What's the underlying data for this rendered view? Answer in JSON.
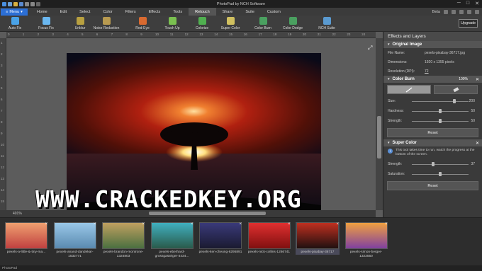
{
  "window": {
    "title": "PhotoPad by NCH Software",
    "controls": [
      "─",
      "□",
      "✕"
    ]
  },
  "menubar": {
    "menu_label": "Menu",
    "tabs": [
      "Home",
      "Edit",
      "Select",
      "Color",
      "Filters",
      "Effects",
      "Tools",
      "Retouch",
      "Share",
      "Suite",
      "Custom"
    ],
    "active_tab": "Retouch",
    "right_label": "Beta"
  },
  "toolbar": {
    "items": [
      {
        "label": "Auto Fix",
        "icon": "auto-fix-icon",
        "color": "#4aa3e8"
      },
      {
        "label": "Focus Fix",
        "icon": "focus-fix-icon",
        "color": "#6ab7f0"
      },
      {
        "label": "Unblur",
        "icon": "unblur-icon",
        "color": "#b8a040"
      },
      {
        "label": "Noise Reduction",
        "icon": "noise-reduction-icon",
        "color": "#b89a50"
      },
      {
        "label": "Red-Eye",
        "icon": "red-eye-icon",
        "color": "#d96a30"
      },
      {
        "label": "Touch Up",
        "icon": "touch-up-icon",
        "color": "#7ac050"
      },
      {
        "label": "Colorize",
        "icon": "colorize-icon",
        "color": "#50b050"
      },
      {
        "label": "Super Color",
        "icon": "super-color-icon",
        "color": "#d0c060"
      },
      {
        "label": "Color Burn",
        "icon": "color-burn-icon",
        "color": "#4aa060"
      },
      {
        "label": "Color Dodge",
        "icon": "color-dodge-icon",
        "color": "#4aa060"
      },
      {
        "label": "NCH Suite",
        "icon": "nch-suite-icon",
        "color": "#5a9ad0"
      }
    ],
    "upgrade_label": "Upgrade"
  },
  "canvas": {
    "ruler_top": [
      "0",
      "1",
      "2",
      "3",
      "4",
      "5",
      "6",
      "7",
      "8",
      "9",
      "10",
      "11",
      "12",
      "13",
      "14",
      "15",
      "16",
      "17",
      "18",
      "19",
      "20",
      "21",
      "22",
      "23",
      "24"
    ],
    "ruler_left": [
      "1",
      "2",
      "3",
      "4",
      "5",
      "6",
      "7",
      "8",
      "9",
      "10",
      "11",
      "12",
      "13",
      "14",
      "15"
    ],
    "zoom": "401%"
  },
  "panel": {
    "title": "Effects and Layers",
    "original_image": {
      "heading": "Original Image",
      "file_name_label": "File Name:",
      "file_name": "pexels-pixabay-36717.jpg",
      "dimensions_label": "Dimensions:",
      "dimensions": "1920 x 1355 pixels",
      "resolution_label": "Resolution (DPI):",
      "resolution": "72"
    },
    "color_burn": {
      "heading": "Color Burn",
      "percent": "100%",
      "sliders": [
        {
          "label": "Size:",
          "value": "200",
          "fraction": 0.75
        },
        {
          "label": "Hardness:",
          "value": "50",
          "fraction": 0.5
        },
        {
          "label": "Strength:",
          "value": "50",
          "fraction": 0.5
        }
      ],
      "reset_label": "Reset"
    },
    "super_color": {
      "heading": "Super Color",
      "info": "This tool takes time to run, watch the progress at the bottom of the screen.",
      "sliders": [
        {
          "label": "Strength:",
          "value": "37",
          "fraction": 0.37
        },
        {
          "label": "Saturation:",
          "value": "",
          "fraction": 0.5
        }
      ],
      "reset_label": "Reset"
    }
  },
  "filmstrip": [
    {
      "caption": "pexels-a-little-&-tiny-ma...",
      "colors": [
        "#f0a070",
        "#c04040"
      ]
    },
    {
      "caption": "pexels-anand-dandekar-1532771",
      "colors": [
        "#9ac8e8",
        "#5a8ab0"
      ]
    },
    {
      "caption": "pexels-brandon-montrone-1324803",
      "colors": [
        "#c0a060",
        "#4a7040"
      ]
    },
    {
      "caption": "pexels-eberhard-grossgasteiger-4434...",
      "colors": [
        "#40b0c0",
        "#2a5a4a"
      ]
    },
    {
      "caption": "pexels-ken-cheung-6295891",
      "colors": [
        "#3a3a7a",
        "#1a1a30"
      ]
    },
    {
      "caption": "pexels-nick-collins-1266741",
      "colors": [
        "#e03030",
        "#801010"
      ]
    },
    {
      "caption": "pexels-pixabay-36717",
      "colors": [
        "#c03020",
        "#201010"
      ]
    },
    {
      "caption": "pexels-simon-berger-1323550",
      "colors": [
        "#f0a040",
        "#8040a0"
      ]
    }
  ],
  "filmstrip_selected": 6,
  "status": "PhotoPad",
  "watermark": "WWW.CRACKEDKEY.ORG"
}
